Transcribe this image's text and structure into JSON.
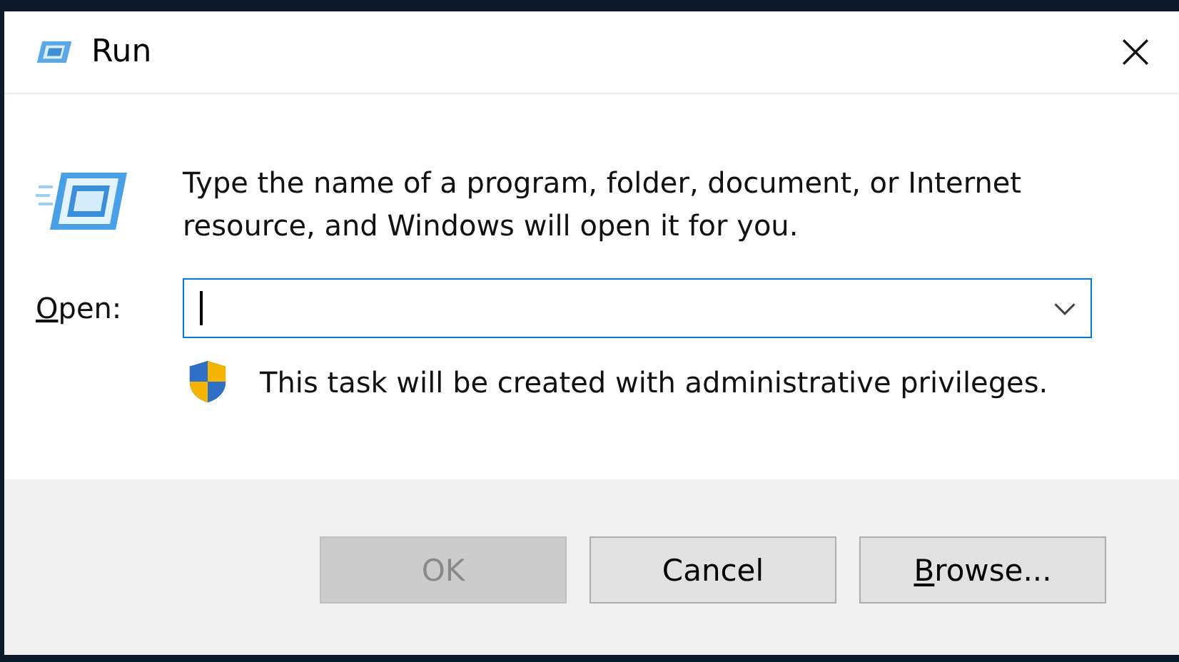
{
  "window": {
    "title": "Run"
  },
  "message": "Type the name of a program, folder, document, or Internet resource, and Windows will open it for you.",
  "open_field": {
    "label": "Open:",
    "access_key": true,
    "focused": true
  },
  "notice": "This task will be created with administrative privileges.",
  "buttons": [
    {
      "label": "OK",
      "disabled": true,
      "access_key": false
    },
    {
      "label": "Cancel",
      "disabled": false,
      "access_key": false
    },
    {
      "label": "Browse...",
      "disabled": false,
      "access_key": true
    }
  ]
}
